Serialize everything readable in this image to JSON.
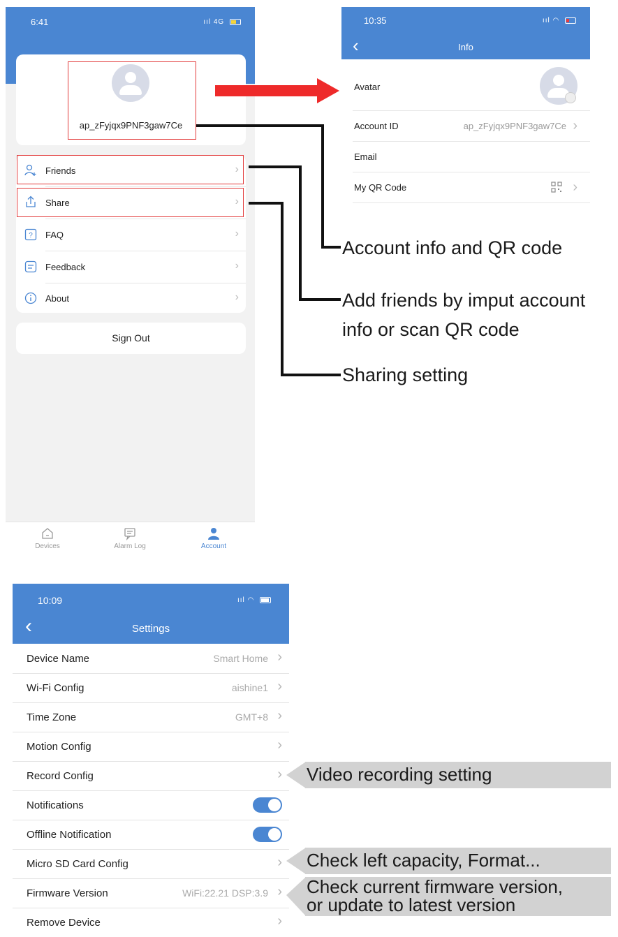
{
  "account_screen": {
    "time": "6:41",
    "signal": "4G",
    "username": "ap_zFyjqx9PNF3gaw7Ce",
    "menu": [
      {
        "label": "Friends",
        "icon": "user-add-icon"
      },
      {
        "label": "Share",
        "icon": "share-icon"
      },
      {
        "label": "FAQ",
        "icon": "question-icon"
      },
      {
        "label": "Feedback",
        "icon": "feedback-icon"
      },
      {
        "label": "About",
        "icon": "info-icon"
      }
    ],
    "sign_out": "Sign Out",
    "tabs": [
      {
        "label": "Devices",
        "icon": "home-icon"
      },
      {
        "label": "Alarm Log",
        "icon": "message-icon"
      },
      {
        "label": "Account",
        "icon": "person-icon",
        "active": true
      }
    ]
  },
  "info_screen": {
    "time": "10:35",
    "title": "Info",
    "rows": [
      {
        "label": "Avatar"
      },
      {
        "label": "Account ID",
        "value": "ap_zFyjqx9PNF3gaw7Ce"
      },
      {
        "label": "Email"
      },
      {
        "label": "My QR Code"
      }
    ]
  },
  "annotations": {
    "account_info": "Account info and QR code",
    "friends_line1": "Add friends by imput account",
    "friends_line2": "info or scan QR code",
    "sharing": "Sharing setting",
    "record": "Video recording setting",
    "sdcard": "Check left capacity, Format...",
    "firmware_line1": "Check current firmware version,",
    "firmware_line2": "or update to latest version"
  },
  "settings_screen": {
    "time": "10:09",
    "title": "Settings",
    "rows": [
      {
        "label": "Device Name",
        "value": "Smart Home"
      },
      {
        "label": "Wi-Fi Config",
        "value": "aishine1"
      },
      {
        "label": "Time Zone",
        "value": "GMT+8"
      },
      {
        "label": "Motion Config",
        "value": ""
      },
      {
        "label": "Record Config",
        "value": ""
      },
      {
        "label": "Notifications",
        "toggle": true
      },
      {
        "label": "Offline Notification",
        "toggle": true
      },
      {
        "label": "Micro SD Card Config",
        "value": ""
      },
      {
        "label": "Firmware Version",
        "value": "WiFi:22.21 DSP:3.9"
      },
      {
        "label": "Remove Device",
        "value": ""
      }
    ]
  },
  "colors": {
    "accent": "#4a86d2",
    "highlight": "#e23a3a",
    "arrow": "#ee2a2a"
  }
}
